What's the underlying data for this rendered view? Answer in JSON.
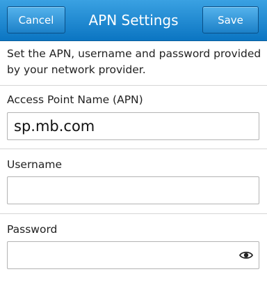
{
  "header": {
    "cancel_label": "Cancel",
    "title": "APN Settings",
    "save_label": "Save"
  },
  "description": "Set the APN, username and password provided by your network provider.",
  "fields": {
    "apn": {
      "label": "Access Point Name (APN)",
      "value": "sp.mb.com"
    },
    "username": {
      "label": "Username",
      "value": ""
    },
    "password": {
      "label": "Password",
      "value": ""
    }
  },
  "icons": {
    "password_toggle": "eye-icon"
  },
  "colors": {
    "header_top": "#3aa1e2",
    "header_bottom": "#0b75c2"
  }
}
